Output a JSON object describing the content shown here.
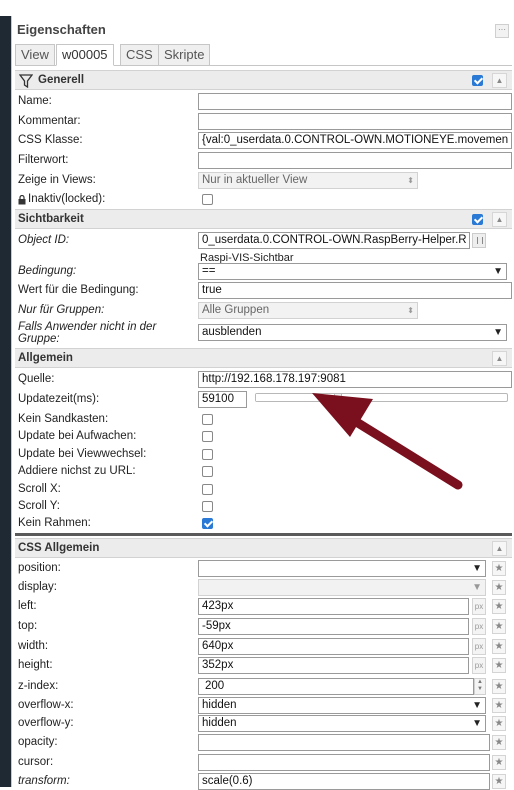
{
  "panel": {
    "title": "Eigenschaften",
    "title_button": "···"
  },
  "tabs": [
    {
      "label": "View",
      "active": false
    },
    {
      "label": "w00005",
      "active": true
    },
    {
      "label": "CSS",
      "active": false
    },
    {
      "label": "Skripte",
      "active": false
    }
  ],
  "sections": {
    "generell": {
      "title": "Generell",
      "checked": true,
      "rows": {
        "name": {
          "label": "Name:",
          "value": ""
        },
        "kommentar": {
          "label": "Kommentar:",
          "value": ""
        },
        "css_klasse": {
          "label": "CSS Klasse:",
          "value": "{val:0_userdata.0.CONTROL-OWN.MOTIONEYE.movemen"
        },
        "filterwort": {
          "label": "Filterwort:",
          "value": ""
        },
        "zeige": {
          "label": "Zeige in Views:",
          "value": "Nur in aktueller View"
        },
        "inaktiv": {
          "label": "Inaktiv(locked):",
          "checked": false
        }
      }
    },
    "sichtbarkeit": {
      "title": "Sichtbarkeit",
      "checked": true,
      "rows": {
        "object_id": {
          "label": "Object ID:",
          "value": "0_userdata.0.CONTROL-OWN.RaspBerry-Helper.R",
          "hint": "Raspi-VIS-Sichtbar"
        },
        "bedingung": {
          "label": "Bedingung:",
          "value": "=="
        },
        "wert": {
          "label": "Wert für die Bedingung:",
          "value": "true"
        },
        "gruppen": {
          "label": "Nur für Gruppen:",
          "value": "Alle Gruppen"
        },
        "falls": {
          "label": "Falls Anwender nicht in der Gruppe:",
          "value": "ausblenden"
        }
      }
    },
    "allgemein": {
      "title": "Allgemein",
      "rows": {
        "quelle": {
          "label": "Quelle:",
          "value": "http://192.168.178.197:9081"
        },
        "updatezeit": {
          "label": "Updatezeit(ms):",
          "value": "59100",
          "slider_level": 0.32
        },
        "sandkasten": {
          "label": "Kein Sandkasten:",
          "checked": false
        },
        "aufwachen": {
          "label": "Update bei Aufwachen:",
          "checked": false
        },
        "viewwechsel": {
          "label": "Update bei Viewwechsel:",
          "checked": false
        },
        "addiere": {
          "label": "Addiere nichst zu URL:",
          "checked": false
        },
        "scrollx": {
          "label": "Scroll X:",
          "checked": false
        },
        "scrolly": {
          "label": "Scroll Y:",
          "checked": false
        },
        "rahmen": {
          "label": "Kein Rahmen:",
          "checked": true
        }
      }
    },
    "css_allgemein": {
      "title": "CSS Allgemein",
      "px_label": "px",
      "star_label": "★",
      "rows": {
        "position": {
          "label": "position:",
          "value": ""
        },
        "display": {
          "label": "display:",
          "value": ""
        },
        "left": {
          "label": "left:",
          "value": "423px"
        },
        "top": {
          "label": "top:",
          "value": "-59px"
        },
        "width": {
          "label": "width:",
          "value": "640px"
        },
        "height": {
          "label": "height:",
          "value": "352px"
        },
        "zindex": {
          "label": "z-index:",
          "value": "200"
        },
        "overflowx": {
          "label": "overflow-x:",
          "value": "hidden"
        },
        "overflowy": {
          "label": "overflow-y:",
          "value": "hidden"
        },
        "opacity": {
          "label": "opacity:",
          "value": ""
        },
        "cursor": {
          "label": "cursor:",
          "value": ""
        },
        "transform": {
          "label": "transform:",
          "value": "scale(0.6)"
        }
      }
    }
  },
  "colors": {
    "checkbox_checked": "#2a79d4",
    "annotation_arrow": "#7a0f1e",
    "section_header": "#ececec",
    "left_dark_bar": "#1f2933"
  },
  "icons": {
    "filter": "filter-icon",
    "collapse": "chevron-up-icon",
    "reset": "star-icon",
    "units": "px-unit-icon"
  }
}
